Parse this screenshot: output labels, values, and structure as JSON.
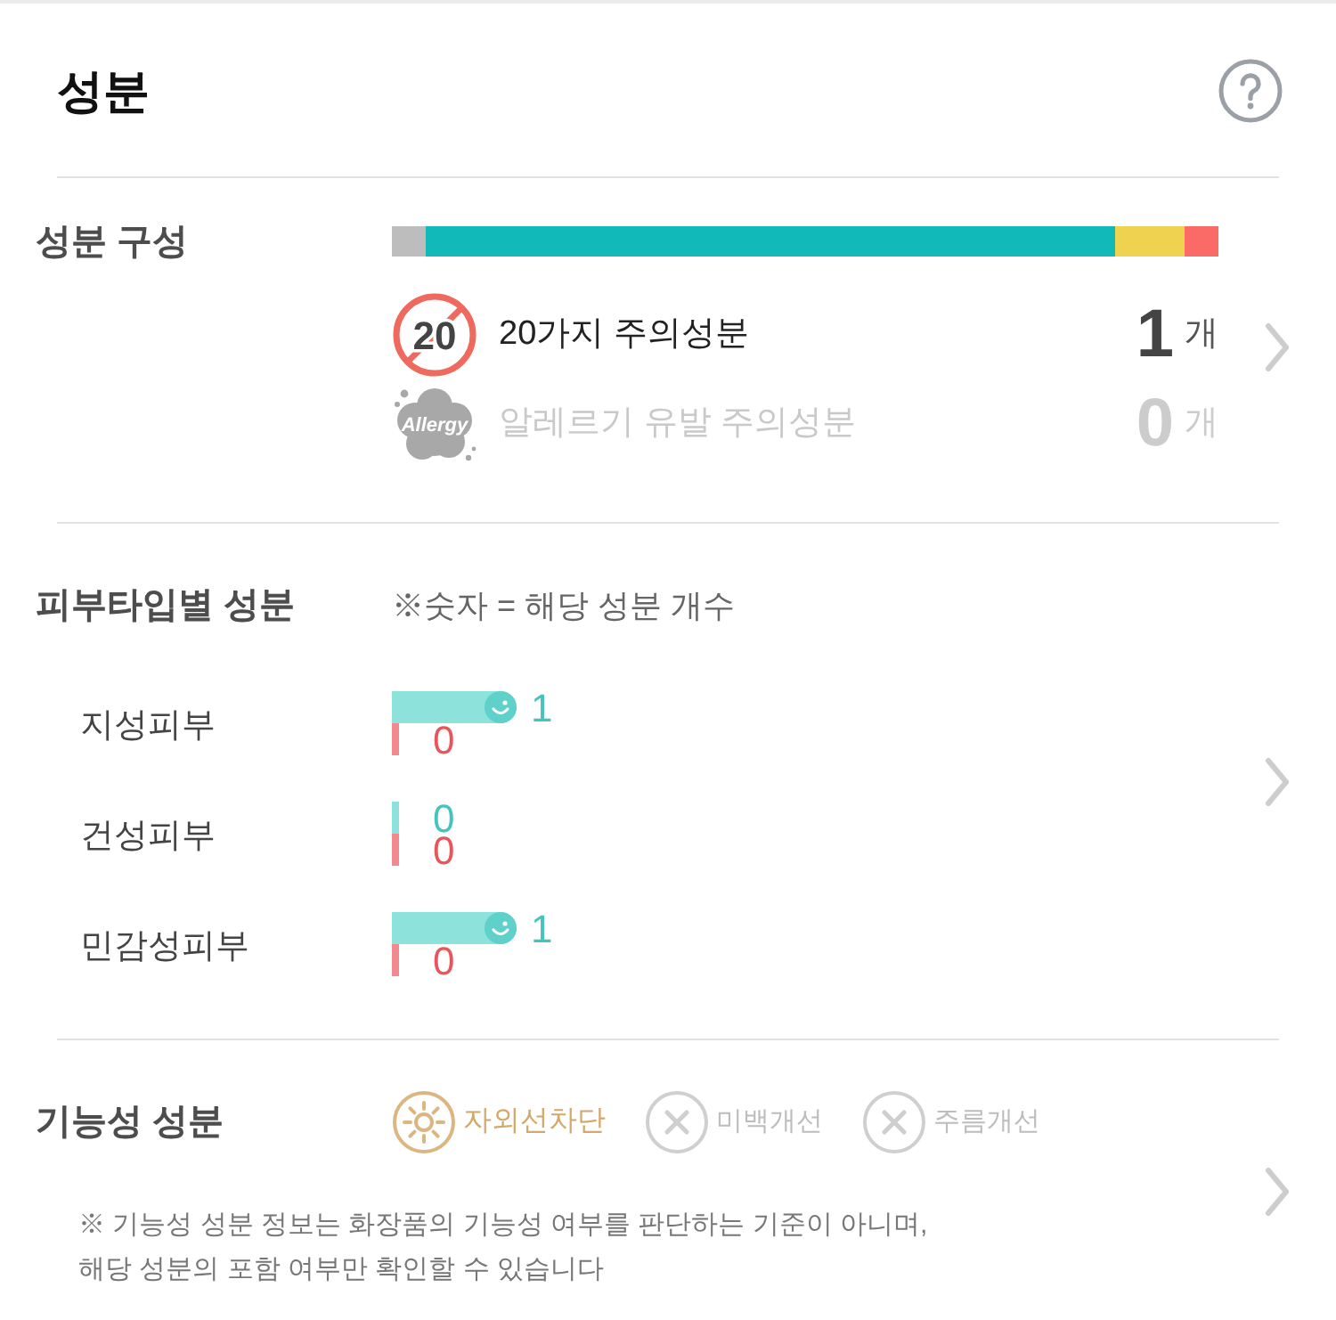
{
  "header": {
    "title": "성분"
  },
  "composition": {
    "label": "성분 구성",
    "segments": [
      {
        "color": "#bdbdbd"
      },
      {
        "color": "#12b9b9"
      },
      {
        "color": "#efd24f"
      },
      {
        "color": "#fa6b68"
      }
    ],
    "warnings": [
      {
        "kind": "twenty",
        "badge": "20",
        "label": "20가지 주의성분",
        "count": "1",
        "unit": "개",
        "active": true
      },
      {
        "kind": "allergy",
        "badge": "Allergy",
        "label": "알레르기 유발 주의성분",
        "count": "0",
        "unit": "개",
        "active": false
      }
    ]
  },
  "skin_types": {
    "label": "피부타입별 성분",
    "note": "※숫자 = 해당 성분 개수",
    "chart_data": {
      "type": "bar",
      "orientation": "horizontal",
      "categories": [
        "지성피부",
        "건성피부",
        "민감성피부"
      ],
      "series": [
        {
          "color": "#8de2dc",
          "values": [
            1,
            0,
            1
          ]
        },
        {
          "color": "#f3898e",
          "values": [
            0,
            0,
            0
          ]
        }
      ],
      "data_labels": true
    }
  },
  "functional": {
    "label": "기능성 성분",
    "items": [
      {
        "kind": "sun",
        "label": "자외선차단",
        "active": true
      },
      {
        "kind": "cross",
        "label": "미백개선",
        "active": false
      },
      {
        "kind": "cross",
        "label": "주름개선",
        "active": false
      }
    ],
    "note": "※ 기능성 성분 정보는 화장품의 기능성 여부를 판단하는 기준이 아니며,\n해당 성분의 포함 여부만 확인할 수 있습니다"
  }
}
